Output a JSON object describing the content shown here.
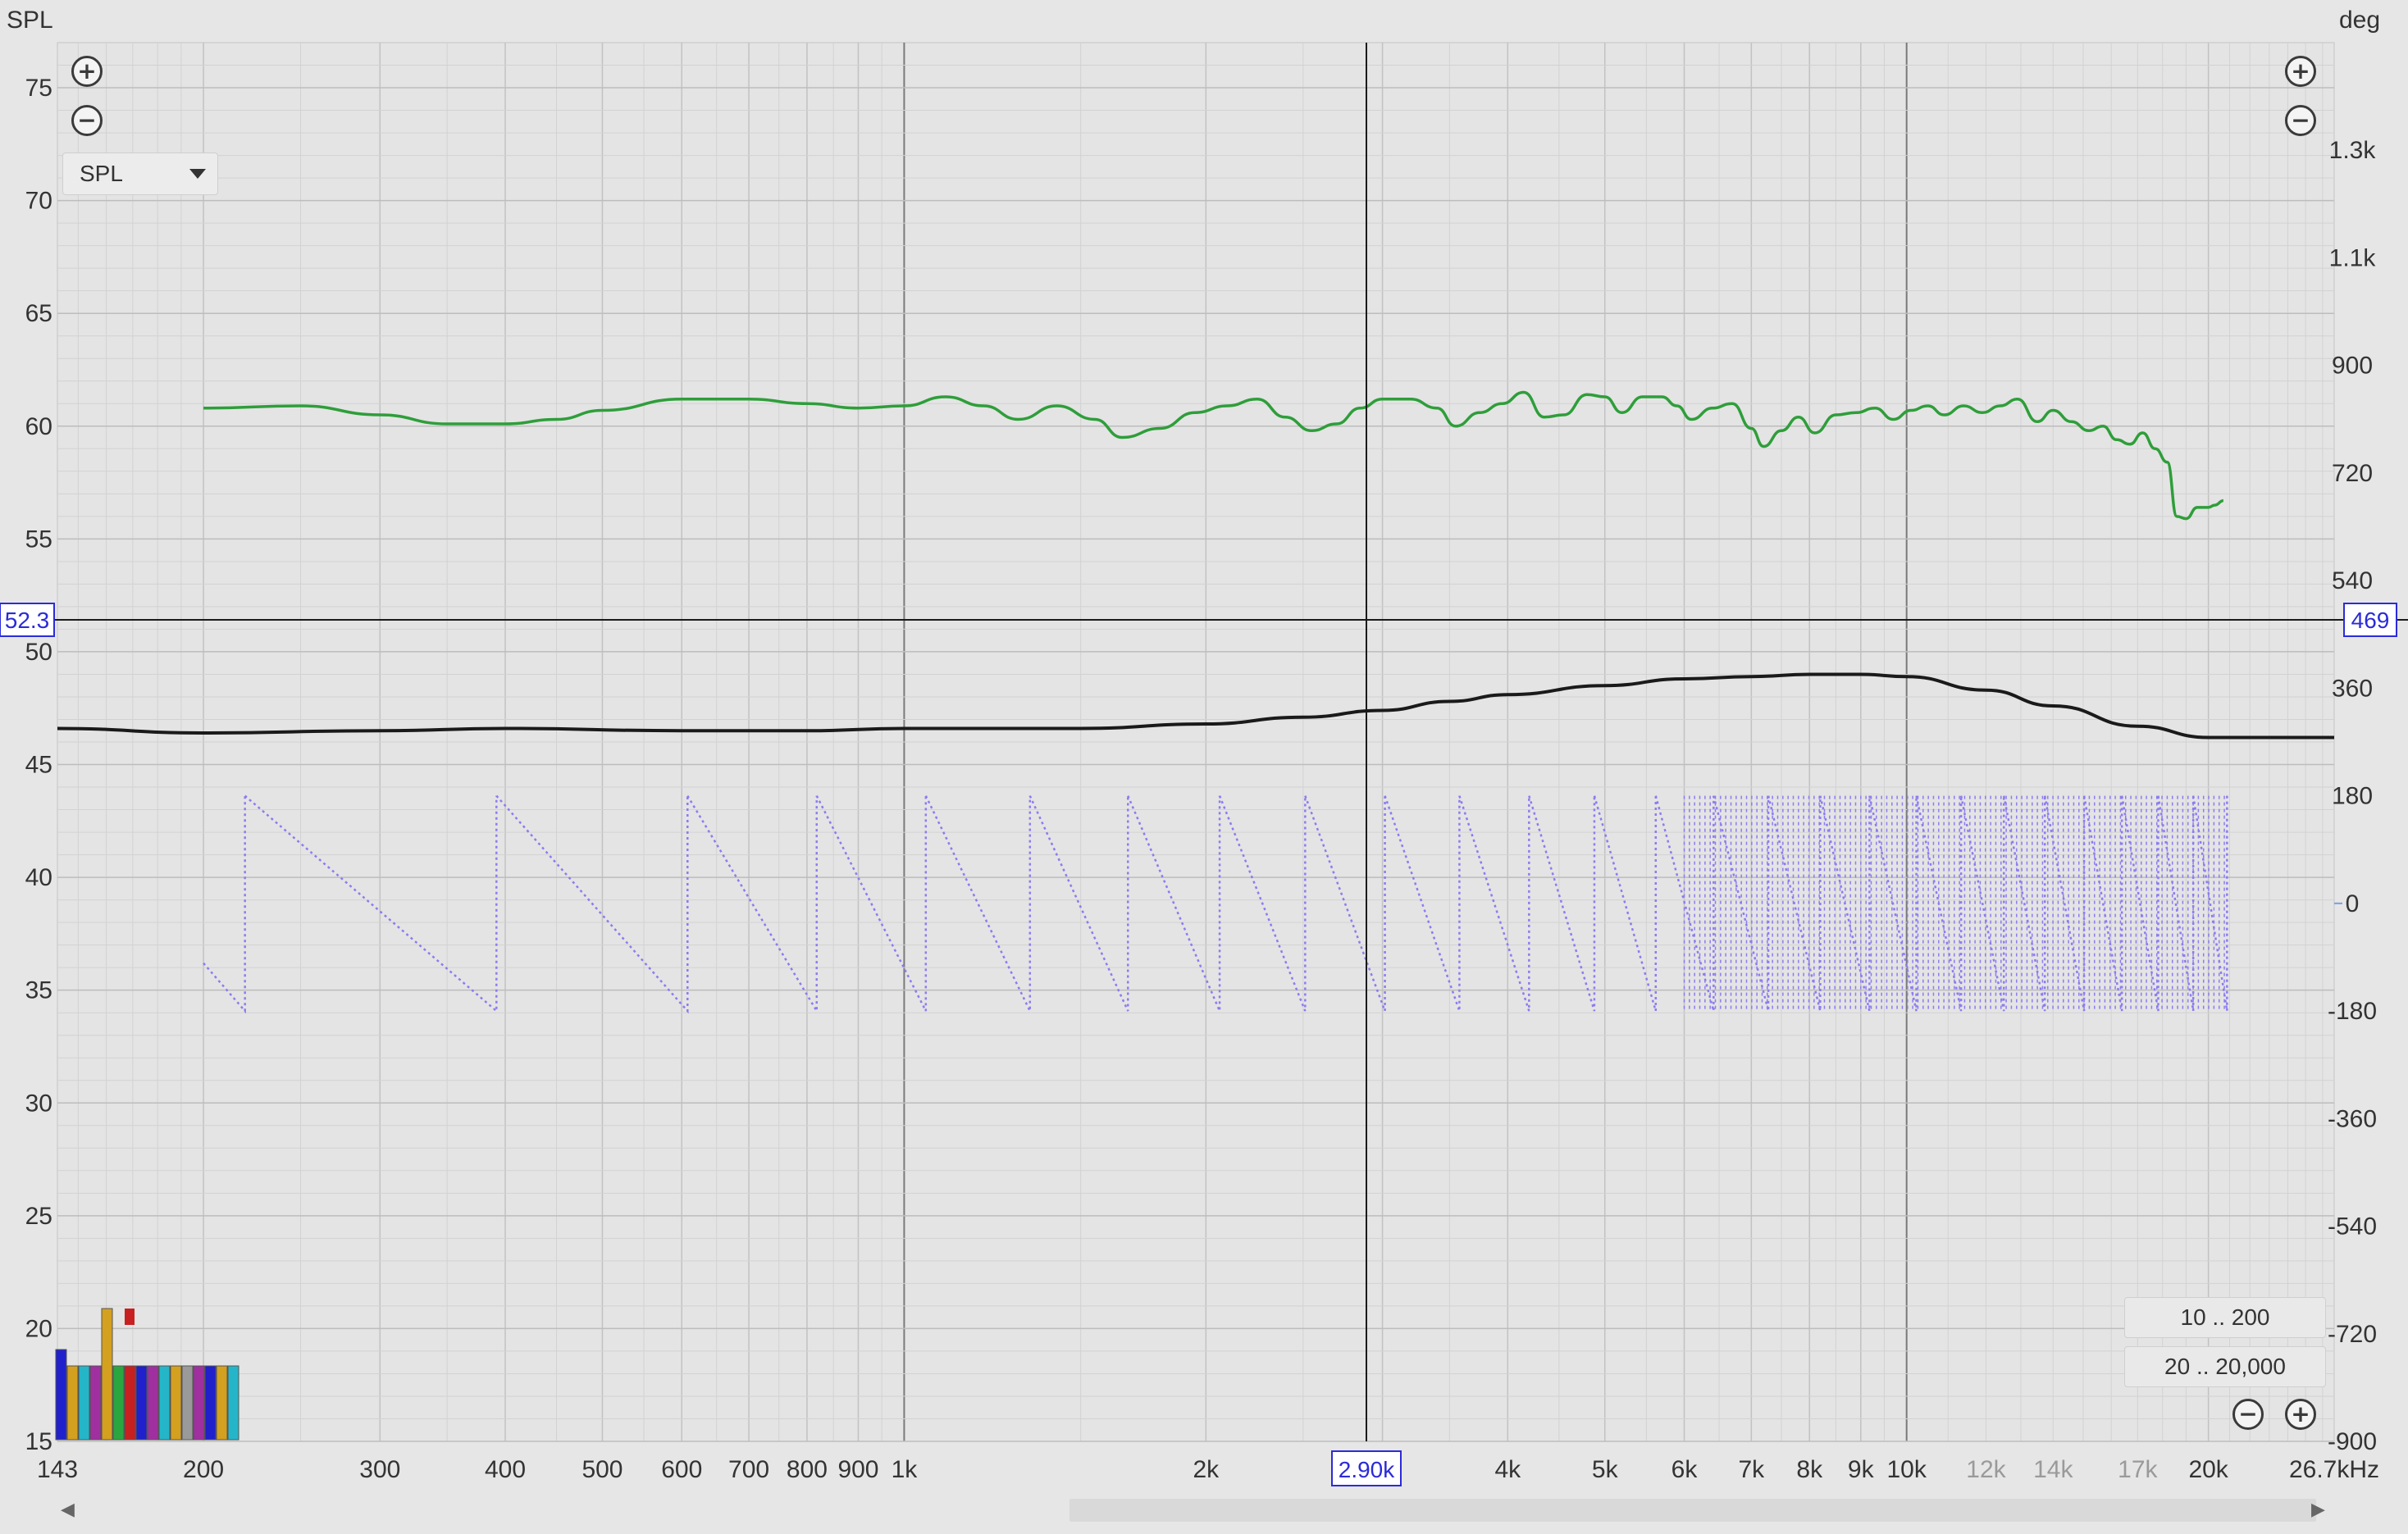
{
  "left_axis": {
    "title": "SPL",
    "ticks": [
      "75",
      "70",
      "65",
      "60",
      "55",
      "50",
      "45",
      "40",
      "35",
      "30",
      "25",
      "20",
      "15"
    ]
  },
  "right_axis": {
    "title": "deg",
    "ticks": [
      "1.3k",
      "1.1k",
      "900",
      "720",
      "540",
      "360",
      "180",
      "0",
      "-180",
      "-360",
      "-540",
      "-720",
      "-900"
    ]
  },
  "x_axis": {
    "unit": "Hz",
    "ticks": [
      {
        "f": 143,
        "label": "143"
      },
      {
        "f": 200,
        "label": "200"
      },
      {
        "f": 300,
        "label": "300"
      },
      {
        "f": 400,
        "label": "400"
      },
      {
        "f": 500,
        "label": "500"
      },
      {
        "f": 600,
        "label": "600"
      },
      {
        "f": 700,
        "label": "700"
      },
      {
        "f": 800,
        "label": "800"
      },
      {
        "f": 900,
        "label": "900"
      },
      {
        "f": 1000,
        "label": "1k"
      },
      {
        "f": 2000,
        "label": "2k"
      },
      {
        "f": 4000,
        "label": "4k"
      },
      {
        "f": 5000,
        "label": "5k"
      },
      {
        "f": 6000,
        "label": "6k"
      },
      {
        "f": 7000,
        "label": "7k"
      },
      {
        "f": 8000,
        "label": "8k"
      },
      {
        "f": 9000,
        "label": "9k"
      },
      {
        "f": 10000,
        "label": "10k"
      },
      {
        "f": 12000,
        "label": "12k",
        "light": true
      },
      {
        "f": 14000,
        "label": "14k",
        "light": true
      },
      {
        "f": 17000,
        "label": "17k",
        "light": true
      },
      {
        "f": 20000,
        "label": "20k"
      },
      {
        "f": 26700,
        "label": "26.7kHz"
      }
    ]
  },
  "cursor": {
    "freq_label": "2.90k",
    "spl_label": "52.3",
    "deg_label": "469"
  },
  "controls": {
    "spl_dropdown": "SPL",
    "range_low": "10 .. 200",
    "range_high": "20 .. 20,000"
  },
  "colors": {
    "spl": "#2e9e3a",
    "trace": "#1a1a1a",
    "phase": "#8c7cf0",
    "cursor": "#2b2bd9"
  },
  "chart_data": {
    "type": "line",
    "x_scale": "log",
    "xlim": [
      143,
      26700
    ],
    "ylim_left": [
      15,
      77
    ],
    "ylim_right": [
      -900,
      1440
    ],
    "grid": true,
    "series": [
      {
        "axis": "left",
        "color": "#2e9e3a",
        "points": [
          [
            200,
            60.8
          ],
          [
            250,
            60.9
          ],
          [
            300,
            60.5
          ],
          [
            350,
            60.1
          ],
          [
            400,
            60.1
          ],
          [
            450,
            60.3
          ],
          [
            500,
            60.7
          ],
          [
            600,
            61.2
          ],
          [
            700,
            61.2
          ],
          [
            800,
            61.0
          ],
          [
            900,
            60.8
          ],
          [
            1000,
            60.9
          ],
          [
            1100,
            61.3
          ],
          [
            1200,
            60.9
          ],
          [
            1300,
            60.3
          ],
          [
            1420,
            60.9
          ],
          [
            1550,
            60.3
          ],
          [
            1650,
            59.5
          ],
          [
            1800,
            59.9
          ],
          [
            1950,
            60.6
          ],
          [
            2100,
            60.9
          ],
          [
            2250,
            61.2
          ],
          [
            2400,
            60.4
          ],
          [
            2550,
            59.8
          ],
          [
            2700,
            60.1
          ],
          [
            2850,
            60.8
          ],
          [
            3000,
            61.2
          ],
          [
            3200,
            61.2
          ],
          [
            3400,
            60.8
          ],
          [
            3550,
            60.0
          ],
          [
            3750,
            60.6
          ],
          [
            3950,
            61.0
          ],
          [
            4150,
            61.5
          ],
          [
            4350,
            60.4
          ],
          [
            4550,
            60.5
          ],
          [
            4800,
            61.4
          ],
          [
            5000,
            61.3
          ],
          [
            5200,
            60.6
          ],
          [
            5450,
            61.3
          ],
          [
            5700,
            61.3
          ],
          [
            5900,
            60.9
          ],
          [
            6100,
            60.3
          ],
          [
            6400,
            60.8
          ],
          [
            6700,
            61.0
          ],
          [
            7000,
            59.9
          ],
          [
            7200,
            59.1
          ],
          [
            7500,
            59.8
          ],
          [
            7800,
            60.4
          ],
          [
            8100,
            59.7
          ],
          [
            8500,
            60.5
          ],
          [
            8900,
            60.6
          ],
          [
            9300,
            60.8
          ],
          [
            9700,
            60.3
          ],
          [
            10100,
            60.7
          ],
          [
            10500,
            60.9
          ],
          [
            10900,
            60.5
          ],
          [
            11400,
            60.9
          ],
          [
            11900,
            60.6
          ],
          [
            12400,
            60.9
          ],
          [
            12900,
            61.2
          ],
          [
            13500,
            60.2
          ],
          [
            14000,
            60.7
          ],
          [
            14600,
            60.2
          ],
          [
            15200,
            59.8
          ],
          [
            15700,
            60.0
          ],
          [
            16200,
            59.4
          ],
          [
            16700,
            59.2
          ],
          [
            17200,
            59.7
          ],
          [
            17700,
            59.0
          ],
          [
            18200,
            58.4
          ],
          [
            18600,
            56.0
          ],
          [
            19000,
            55.9
          ],
          [
            19500,
            56.4
          ],
          [
            20000,
            56.4
          ],
          [
            20300,
            56.5
          ],
          [
            20700,
            56.7
          ]
        ]
      },
      {
        "axis": "left",
        "color": "#1a1a1a",
        "points": [
          [
            143,
            46.6
          ],
          [
            200,
            46.4
          ],
          [
            300,
            46.5
          ],
          [
            400,
            46.6
          ],
          [
            600,
            46.5
          ],
          [
            800,
            46.5
          ],
          [
            1000,
            46.6
          ],
          [
            1500,
            46.6
          ],
          [
            2000,
            46.8
          ],
          [
            2500,
            47.1
          ],
          [
            3000,
            47.4
          ],
          [
            3500,
            47.8
          ],
          [
            4000,
            48.1
          ],
          [
            5000,
            48.5
          ],
          [
            6000,
            48.8
          ],
          [
            7000,
            48.9
          ],
          [
            8000,
            49.0
          ],
          [
            9000,
            49.0
          ],
          [
            10000,
            48.9
          ],
          [
            12000,
            48.3
          ],
          [
            14000,
            47.6
          ],
          [
            17000,
            46.7
          ],
          [
            20000,
            46.2
          ],
          [
            26700,
            46.2
          ]
        ]
      },
      {
        "axis": "right",
        "color": "#8c7cf0",
        "style": "dotted sawtooth wrapping between -180 and 180",
        "wrap_frequencies": [
          220,
          392,
          608,
          818,
          1051,
          1335,
          1672,
          2064,
          2512,
          3017,
          3580,
          4201,
          4881,
          5620,
          6419,
          7279,
          8200,
          9182,
          10226,
          11333,
          12503,
          13736,
          15034,
          16396,
          17823,
          19316,
          20874
        ],
        "x_end": 20874
      }
    ],
    "histogram_legend": {
      "colors": [
        "#2020cc",
        "#d4a020",
        "#24b6c8",
        "#a030a0",
        "#d4a020",
        "#2aa640",
        "#c82020",
        "#2020cc",
        "#a030a0",
        "#24b6c8",
        "#d4a020",
        "#9a9a9a",
        "#a030a0"
      ]
    }
  }
}
